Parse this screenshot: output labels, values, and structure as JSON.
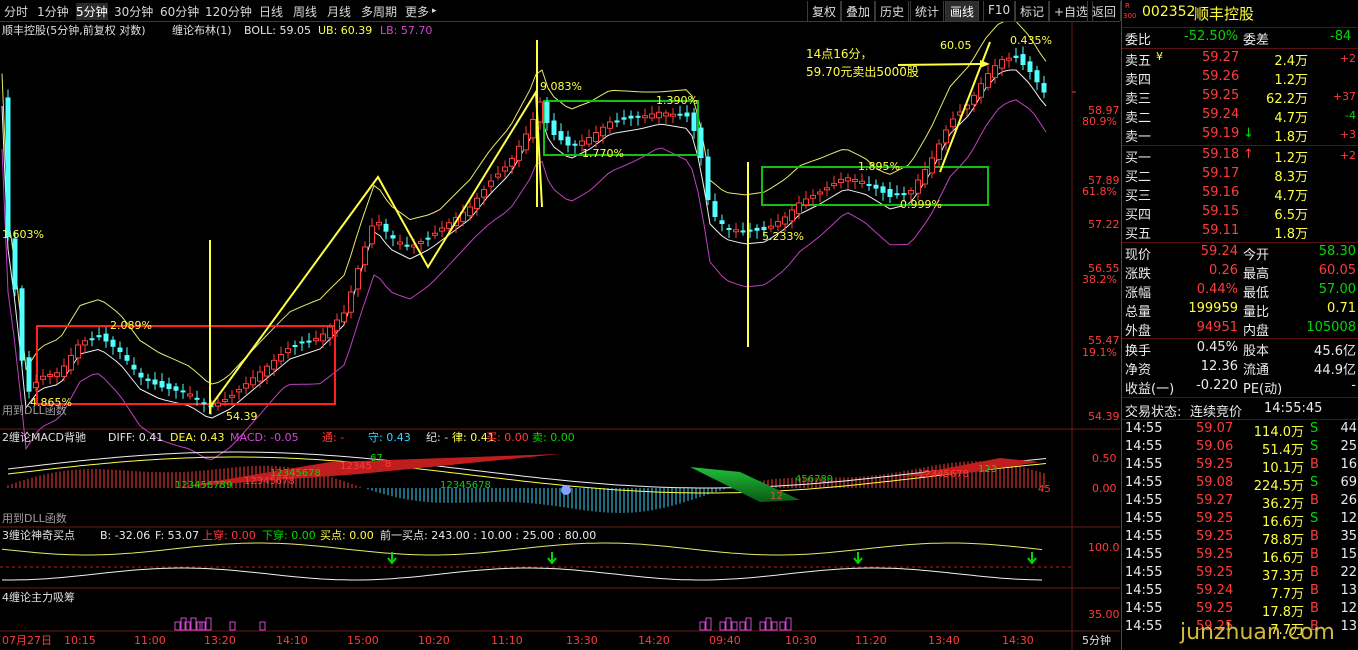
{
  "toolbar": {
    "periods": [
      "分时",
      "1分钟",
      "5分钟",
      "30分钟",
      "60分钟",
      "120分钟",
      "日线",
      "周线",
      "月线",
      "多周期",
      "更多"
    ],
    "active_period": "5分钟",
    "more_arrow": "▸",
    "right_buttons": [
      "复权",
      "叠加",
      "历史",
      "统计",
      "画线",
      "F10",
      "标记",
      "+自选",
      "返回"
    ],
    "active_right": "画线"
  },
  "main": {
    "header": {
      "stock": "顺丰控股(5分钟,前复权 对数)",
      "indicator": "缠论布林(1)",
      "boll_label": "BOLL: 59.05",
      "ub_label": "UB: 60.39",
      "lb_label": "LB: 57.70"
    },
    "annotation": {
      "line1": "14点16分，",
      "line2": "59.70元卖出5000股"
    },
    "price_axis": [
      "58.97",
      "57.89",
      "57.22",
      "56.55",
      "55.47",
      "54.39"
    ],
    "pct_axis": [
      "80.9%",
      "61.8%",
      "38.2%",
      "19.1%"
    ],
    "labels": [
      "1.603%",
      "4.865%",
      "2.089%",
      "54.39",
      "9.083%",
      "1.390%",
      "1.770%",
      "1.895%",
      "0.999%",
      "60.05",
      "5.233%",
      "0.435%"
    ],
    "watermark_left": "用到DLL函数"
  },
  "macd": {
    "title": "2缠论MACD背驰",
    "diff": "DIFF: 0.41",
    "dea": "DEA: 0.43",
    "macd": "MACD: -0.05",
    "tags": [
      "通: -",
      "守: 0.43",
      "纪: -",
      "律: 0.41",
      "买: 0.00",
      "卖: 0.00"
    ],
    "axis": [
      "0.50",
      "0.00"
    ],
    "seqs": [
      "123456789",
      "12345678",
      "12345678",
      "12345",
      "67",
      "8",
      "12345678",
      "12",
      "456789",
      "12345678",
      "123",
      "45"
    ],
    "watermark": "用到DLL函数"
  },
  "buypoint": {
    "title": "3缠论神奇买点",
    "b": "B: -32.06",
    "f": "F: 53.07",
    "up": "上穿: 0.00",
    "down": "下穿: 0.00",
    "buy": "买点: 0.00",
    "prev": "前一买点: 243.00 : 10.00 : 25.00 : 80.00",
    "axis": [
      "100.0",
      "0"
    ]
  },
  "chip": {
    "title": "4缠论主力吸筹",
    "axis": [
      "35.00"
    ]
  },
  "time_axis": [
    "07月27日",
    "10:15",
    "11:00",
    "13:20",
    "14:10",
    "15:00",
    "10:20",
    "11:10",
    "13:30",
    "14:20",
    "09:40",
    "10:30",
    "11:20",
    "13:40",
    "14:30"
  ],
  "period_tag": "5分钟",
  "quote": {
    "badge_r": "R",
    "badge_num": "300",
    "code": "002352",
    "name": "顺丰控股",
    "weibi_label": "委比",
    "weibi_val": "-52.50%",
    "weicha_label": "委差",
    "weicha_val": "-84",
    "asks": [
      {
        "label": "卖五",
        "flag": "¥",
        "price": "59.27",
        "vol": "2.4万",
        "chg": "+2"
      },
      {
        "label": "卖四",
        "flag": "",
        "price": "59.26",
        "vol": "1.2万",
        "chg": ""
      },
      {
        "label": "卖三",
        "flag": "",
        "price": "59.25",
        "vol": "62.2万",
        "chg": "+37"
      },
      {
        "label": "卖二",
        "flag": "",
        "price": "59.24",
        "vol": "4.7万",
        "chg": "-4"
      },
      {
        "label": "卖一",
        "flag": "",
        "price": "59.19",
        "vol": "1.8万",
        "chg": "+3",
        "arrow": "↓"
      }
    ],
    "bids": [
      {
        "label": "买一",
        "price": "59.18",
        "vol": "1.2万",
        "chg": "+2",
        "arrow": "↑"
      },
      {
        "label": "买二",
        "price": "59.17",
        "vol": "8.3万",
        "chg": ""
      },
      {
        "label": "买三",
        "price": "59.16",
        "vol": "4.7万",
        "chg": ""
      },
      {
        "label": "买四",
        "price": "59.15",
        "vol": "6.5万",
        "chg": ""
      },
      {
        "label": "买五",
        "price": "59.11",
        "vol": "1.8万",
        "chg": ""
      }
    ],
    "stats": [
      {
        "l1": "现价",
        "v1": "59.24",
        "c1": "red",
        "l2": "今开",
        "v2": "58.30",
        "c2": "green"
      },
      {
        "l1": "涨跌",
        "v1": "0.26",
        "c1": "red",
        "l2": "最高",
        "v2": "60.05",
        "c2": "red"
      },
      {
        "l1": "涨幅",
        "v1": "0.44%",
        "c1": "red",
        "l2": "最低",
        "v2": "57.00",
        "c2": "green"
      },
      {
        "l1": "总量",
        "v1": "199959",
        "c1": "yellow",
        "l2": "量比",
        "v2": "0.71",
        "c2": "yellow"
      },
      {
        "l1": "外盘",
        "v1": "94951",
        "c1": "red",
        "l2": "内盘",
        "v2": "105008",
        "c2": "green"
      }
    ],
    "stats2": [
      {
        "l1": "换手",
        "v1": "0.45%",
        "c1": "white",
        "l2": "股本",
        "v2": "45.6亿",
        "c2": "white"
      },
      {
        "l1": "净资",
        "v1": "12.36",
        "c1": "white",
        "l2": "流通",
        "v2": "44.9亿",
        "c2": "white"
      },
      {
        "l1": "收益(一)",
        "v1": "-0.220",
        "c1": "white",
        "l2": "PE(动)",
        "v2": "-",
        "c2": "white"
      }
    ],
    "trade_state_label": "交易状态:",
    "trade_state": "连续竞价",
    "trade_time": "14:55:45",
    "ticks": [
      {
        "t": "14:55",
        "p": "59.07",
        "v": "114.0万",
        "s": "S",
        "n": "44"
      },
      {
        "t": "14:55",
        "p": "59.06",
        "v": "51.4万",
        "s": "S",
        "n": "25"
      },
      {
        "t": "14:55",
        "p": "59.25",
        "v": "10.1万",
        "s": "B",
        "n": "16"
      },
      {
        "t": "14:55",
        "p": "59.08",
        "v": "224.5万",
        "s": "S",
        "n": "69"
      },
      {
        "t": "14:55",
        "p": "59.27",
        "v": "36.2万",
        "s": "B",
        "n": "26"
      },
      {
        "t": "14:55",
        "p": "59.25",
        "v": "16.6万",
        "s": "S",
        "n": "12"
      },
      {
        "t": "14:55",
        "p": "59.25",
        "v": "78.8万",
        "s": "B",
        "n": "35"
      },
      {
        "t": "14:55",
        "p": "59.25",
        "v": "16.6万",
        "s": "B",
        "n": "15"
      },
      {
        "t": "14:55",
        "p": "59.25",
        "v": "37.3万",
        "s": "B",
        "n": "22"
      },
      {
        "t": "14:55",
        "p": "59.24",
        "v": "7.7万",
        "s": "B",
        "n": "13"
      },
      {
        "t": "14:55",
        "p": "59.25",
        "v": "17.8万",
        "s": "B",
        "n": "12"
      },
      {
        "t": "14:55",
        "p": "59.25",
        "v": "7.7万",
        "s": "B",
        "n": "13"
      },
      {
        "t": "14:55",
        "p": "59.24",
        "v": "7.7万",
        "s": "B",
        "n": "13"
      }
    ]
  },
  "watermark": "junzhuan.com"
}
